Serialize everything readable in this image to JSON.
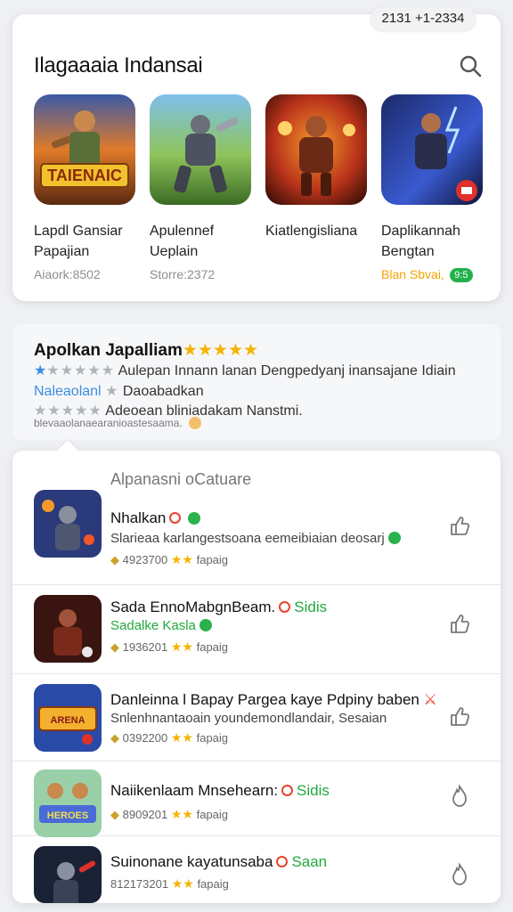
{
  "status": {
    "time": "2131 +1-2334"
  },
  "top": {
    "title": "Ilagaaaia Indansai",
    "featured": [
      {
        "name": "Lapdl Gansiar Papajian",
        "meta": "Aiaork:8502",
        "meta_color": "grey",
        "badge": "",
        "icon": "game-icon-tainenaic"
      },
      {
        "name": "Apulennef Ueplain",
        "meta": "Storre:2372",
        "meta_color": "grey",
        "badge": "",
        "icon": "game-icon-armored-warrior"
      },
      {
        "name": "Kiatlengisliana",
        "meta": "",
        "meta_color": "grey",
        "badge": "",
        "icon": "game-icon-fire-warrior"
      },
      {
        "name": "Daplikannah Bengtan",
        "meta": "Blan Sbvai,",
        "meta_color": "orange",
        "badge": "9:5",
        "icon": "game-icon-lightning-hero"
      }
    ]
  },
  "review": {
    "title": "Apolkan Japalliam",
    "title_stars": "★★★★★",
    "line1_stars": "★★★★★",
    "line1_text": "Aulepan Innann lanan Dengpedyanj inansajane Idiain",
    "line2_label": "Naleaolanl",
    "line2_text": "Daoabadkan",
    "line3_stars": "★★★★★",
    "line3_text": "Adeoean bliniadakam Nanstmi.",
    "footer": "blevaaolanaearanioastesaama."
  },
  "list": {
    "header": "Alpanasni oCatuare",
    "items": [
      {
        "title": "Nhalkan",
        "sub": "Slarieaa karlangestsoana eemeibiaian deosarj",
        "rating": "4923700",
        "label": "fapaig",
        "icon": "game-icon-knight"
      },
      {
        "title": "Sada EnnoMabgnBeam.",
        "tag": "Sidis",
        "sub": "Sadalke Kasla",
        "rating": "1936201",
        "label": "fapaig",
        "icon": "game-icon-warlord"
      },
      {
        "title": "Danleinna l Bapay Pargea kaye Pdpiny baben",
        "sub": "Snlenhnantaoain youndemondlandair, Sesaian",
        "rating": "0392200",
        "label": "fapaig",
        "icon": "game-icon-arena"
      },
      {
        "title": "Naiikenlaam Mnsehearn:",
        "tag": "Sidis",
        "sub": "",
        "rating": "8909201",
        "label": "fapaig",
        "icon": "game-icon-heroes"
      },
      {
        "title": "Suinonane kayatunsaba",
        "tag": "Saan",
        "sub": "",
        "rating": "812173201",
        "label": "fapaig",
        "icon": "game-icon-space-ranger"
      }
    ]
  },
  "colors": {
    "accent_green": "#22a93d",
    "accent_orange": "#f4a300",
    "star": "#f5b301",
    "link_blue": "#3c8de0"
  }
}
